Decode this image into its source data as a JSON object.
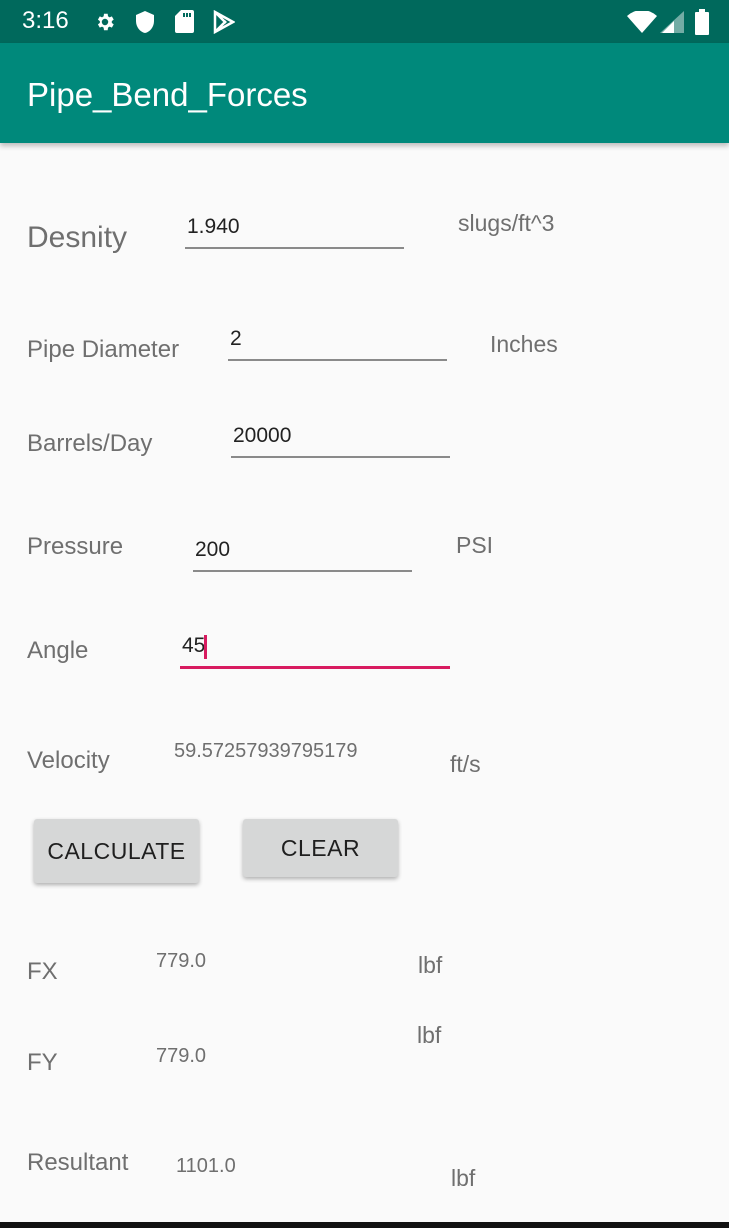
{
  "status_bar": {
    "time": "3:16",
    "icons": [
      "gear-icon",
      "shield-icon",
      "sd-card-icon",
      "play-store-icon",
      "wifi-icon",
      "cell-signal-icon",
      "battery-icon"
    ]
  },
  "app_bar": {
    "title": "Pipe_Bend_Forces",
    "color": "#00897b"
  },
  "form": {
    "density": {
      "label": "Desnity",
      "value": "1.940",
      "unit": "slugs/ft^3"
    },
    "diameter": {
      "label": "Pipe Diameter",
      "value": "2",
      "unit": "Inches"
    },
    "barrels": {
      "label": "Barrels/Day",
      "value": "20000"
    },
    "pressure": {
      "label": "Pressure",
      "value": "200",
      "unit": "PSI"
    },
    "angle": {
      "label": "Angle",
      "value": "45"
    },
    "velocity": {
      "label": "Velocity",
      "value": "59.57257939795179",
      "unit": "ft/s"
    }
  },
  "buttons": {
    "calculate": "CALCULATE",
    "clear": "CLEAR"
  },
  "results": {
    "fx": {
      "label": "FX",
      "value": "779.0",
      "unit": "lbf"
    },
    "fy": {
      "label": "FY",
      "value": "779.0",
      "unit": "lbf"
    },
    "resultant": {
      "label": "Resultant",
      "value": "1101.0",
      "unit": "lbf"
    }
  },
  "colors": {
    "accent": "#d81b60",
    "status_bar": "#00695c"
  }
}
